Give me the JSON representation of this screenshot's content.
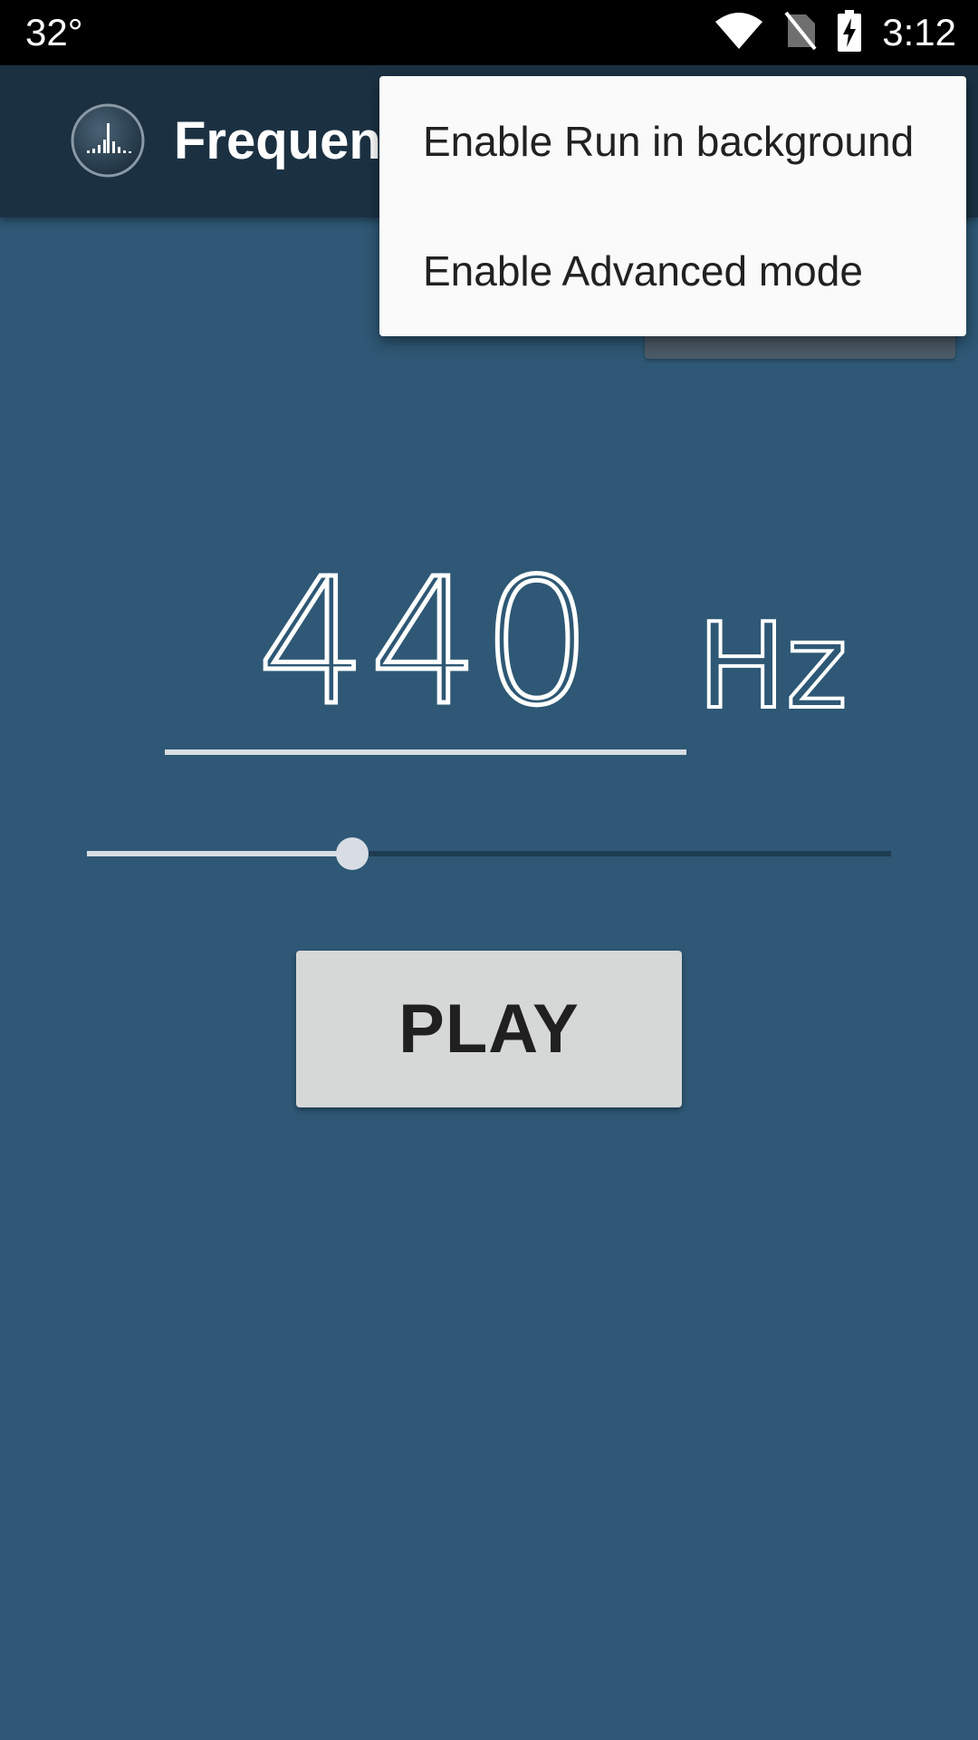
{
  "status_bar": {
    "temperature": "32°",
    "time": "3:12",
    "icons": [
      "wifi-icon",
      "no-sim-icon",
      "battery-charging-icon"
    ]
  },
  "app_bar": {
    "title": "Frequency Sound Generator",
    "logo_icon": "equalizer-logo-icon"
  },
  "main": {
    "frequency_value": "440",
    "frequency_unit": "Hz",
    "slider_level": 0.33,
    "play_label": "PLAY"
  },
  "popup_menu": {
    "items": [
      {
        "label": "Enable Run in background"
      },
      {
        "label": "Enable Advanced mode"
      }
    ]
  },
  "colors": {
    "background": "#2e5875",
    "app_bar": "#1b3142",
    "status_bar": "#000000",
    "accent_light": "#d7dde3",
    "play_button": "#d6d7d7",
    "menu_background": "#fafafa"
  }
}
